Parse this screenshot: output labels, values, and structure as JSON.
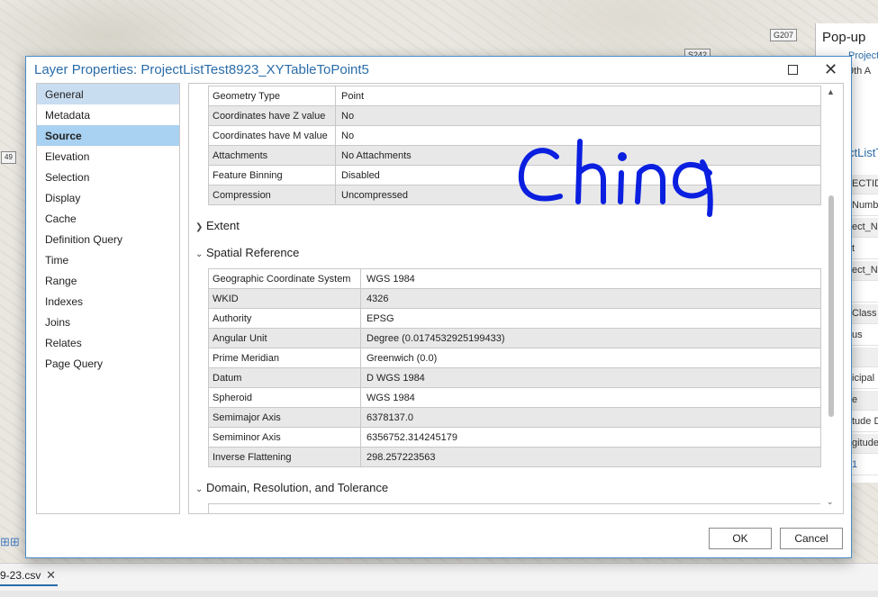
{
  "map": {
    "road_labels": [
      "G207",
      "S242",
      "S242"
    ],
    "edge_label": "49"
  },
  "popup": {
    "title": "Pop-up",
    "items": [
      "ProjectLis",
      "9th A"
    ],
    "layer_link": "ctListT",
    "rows": [
      "ECTID",
      "Numbe",
      "ect_Nu",
      "t",
      "ect_Na",
      "",
      "Class",
      "us",
      "",
      "icipal",
      "e",
      "tude D",
      "gitude",
      "1"
    ]
  },
  "bottom": {
    "csv_tab": "9-23.csv",
    "csv_close": "✕"
  },
  "dialog": {
    "title": "Layer Properties: ProjectListTest8923_XYTableToPoint5",
    "maximize": "",
    "close": "✕",
    "nav": [
      {
        "label": "General",
        "state": "hover"
      },
      {
        "label": "Metadata",
        "state": ""
      },
      {
        "label": "Source",
        "state": "selected"
      },
      {
        "label": "Elevation",
        "state": ""
      },
      {
        "label": "Selection",
        "state": ""
      },
      {
        "label": "Display",
        "state": ""
      },
      {
        "label": "Cache",
        "state": ""
      },
      {
        "label": "Definition Query",
        "state": ""
      },
      {
        "label": "Time",
        "state": ""
      },
      {
        "label": "Range",
        "state": ""
      },
      {
        "label": "Indexes",
        "state": ""
      },
      {
        "label": "Joins",
        "state": ""
      },
      {
        "label": "Relates",
        "state": ""
      },
      {
        "label": "Page Query",
        "state": ""
      }
    ],
    "top_table": [
      {
        "key": "Geometry Type",
        "value": "Point"
      },
      {
        "key": "Coordinates have Z value",
        "value": "No"
      },
      {
        "key": "Coordinates have M value",
        "value": "No"
      },
      {
        "key": "Attachments",
        "value": "No Attachments"
      },
      {
        "key": "Feature Binning",
        "value": "Disabled"
      },
      {
        "key": "Compression",
        "value": "Uncompressed"
      }
    ],
    "sections": {
      "extent": "Extent",
      "spatial_reference": "Spatial Reference",
      "domain": "Domain, Resolution, and Tolerance"
    },
    "sr_table": [
      {
        "key": "Geographic Coordinate System",
        "value": "WGS 1984"
      },
      {
        "key": "WKID",
        "value": "4326"
      },
      {
        "key": "Authority",
        "value": "EPSG"
      },
      {
        "key": "Angular Unit",
        "value": "Degree (0.0174532925199433)"
      },
      {
        "key": "Prime Meridian",
        "value": "Greenwich (0.0)"
      },
      {
        "key": "Datum",
        "value": "D WGS 1984"
      },
      {
        "key": "Spheroid",
        "value": "WGS 1984"
      },
      {
        "key": "Semimajor Axis",
        "value": "6378137.0"
      },
      {
        "key": "Semiminor Axis",
        "value": "6356752.314245179"
      },
      {
        "key": "Inverse Flattening",
        "value": "298.257223563"
      }
    ],
    "ok_label": "OK",
    "cancel_label": "Cancel"
  },
  "annotation": {
    "handwritten_text": "China",
    "color": "#0b1fe0"
  },
  "colors": {
    "accent": "#2a6ca8",
    "nav_selected": "#a9d1f1",
    "nav_hover": "#c9ddf0"
  }
}
